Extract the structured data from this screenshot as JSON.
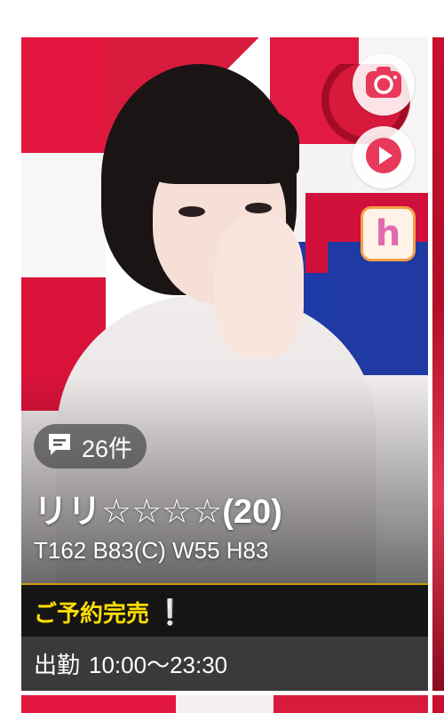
{
  "card": {
    "review": {
      "icon": "comment-icon",
      "count_label": "26件"
    },
    "name": "リリ☆☆☆☆(20)",
    "specs": "T162 B83(C) W55 H83",
    "status": {
      "text": "ご予約完売",
      "mark": "❕"
    },
    "schedule": {
      "label": "出勤",
      "time": "10:00〜23:30"
    },
    "icons": [
      "camera-icon",
      "play-icon",
      "h-logo-icon"
    ]
  },
  "colors": {
    "accent_red": "#e8395b",
    "status_yellow": "#ffdd00",
    "status_bg": "#151515",
    "schedule_bg": "#3a3a3a"
  }
}
